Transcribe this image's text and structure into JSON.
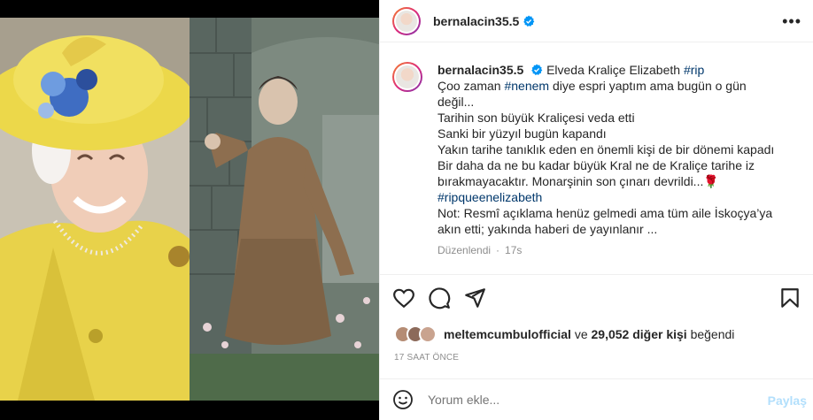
{
  "post": {
    "username": "bernalacin35.5",
    "caption_user": "bernalacin35.5",
    "caption_lines": [
      {
        "prefix": "",
        "tag": "",
        "text": "Elveda Kraliçe Elizabeth "
      },
      {
        "prefix": "",
        "tag": "#rip",
        "text": ""
      }
    ],
    "caption_first": "Elveda Kraliçe Elizabeth",
    "caption_first_tag": "#rip",
    "line2_pre": "Çoo zaman",
    "line2_tag": "#nenem",
    "line2_post": "diye espri yaptım ama bugün o gün",
    "line3": "değil...",
    "line4": "Tarihin son büyük Kraliçesi veda etti",
    "line5": "Sanki bir yüzyıl bugün kapandı",
    "line6": "Yakın tarihe tanıklık eden en önemli kişi de bir dönemi kapadı",
    "line7": "Bir daha da ne bu kadar büyük Kral ne de Kraliçe tarihe iz",
    "line8": "bırakmayacaktır. Monarşinin son çınarı devrildi...🌹",
    "line9_tag": "#ripqueenelizabeth",
    "line10": "Not: Resmî açıklama henüz gelmedi ama tüm aile İskoçya’ya",
    "line11": "akın etti; yakında haberi de yayınlanır ...",
    "edited": "Düzenlendi",
    "sep": "·",
    "age": "17s"
  },
  "likes": {
    "top_liker": "meltemcumbulofficial",
    "and": "ve",
    "count_text": "29,052 diğer kişi",
    "liked": "beğendi"
  },
  "timestamp": "17 SAAT ÖNCE",
  "comment": {
    "placeholder": "Yorum ekle...",
    "share": "Paylaş"
  },
  "icons": [
    "verified-badge-icon",
    "more-icon",
    "heart-icon",
    "comment-icon",
    "share-icon",
    "bookmark-icon",
    "emoji-icon"
  ],
  "colors": {
    "verified": "#0095f6",
    "hashtag": "#00376b",
    "muted": "#8e8e8e",
    "share_disabled": "#b2dffc",
    "coat_yellow": "#e8d24a",
    "suit_brown": "#8d6e4f"
  }
}
